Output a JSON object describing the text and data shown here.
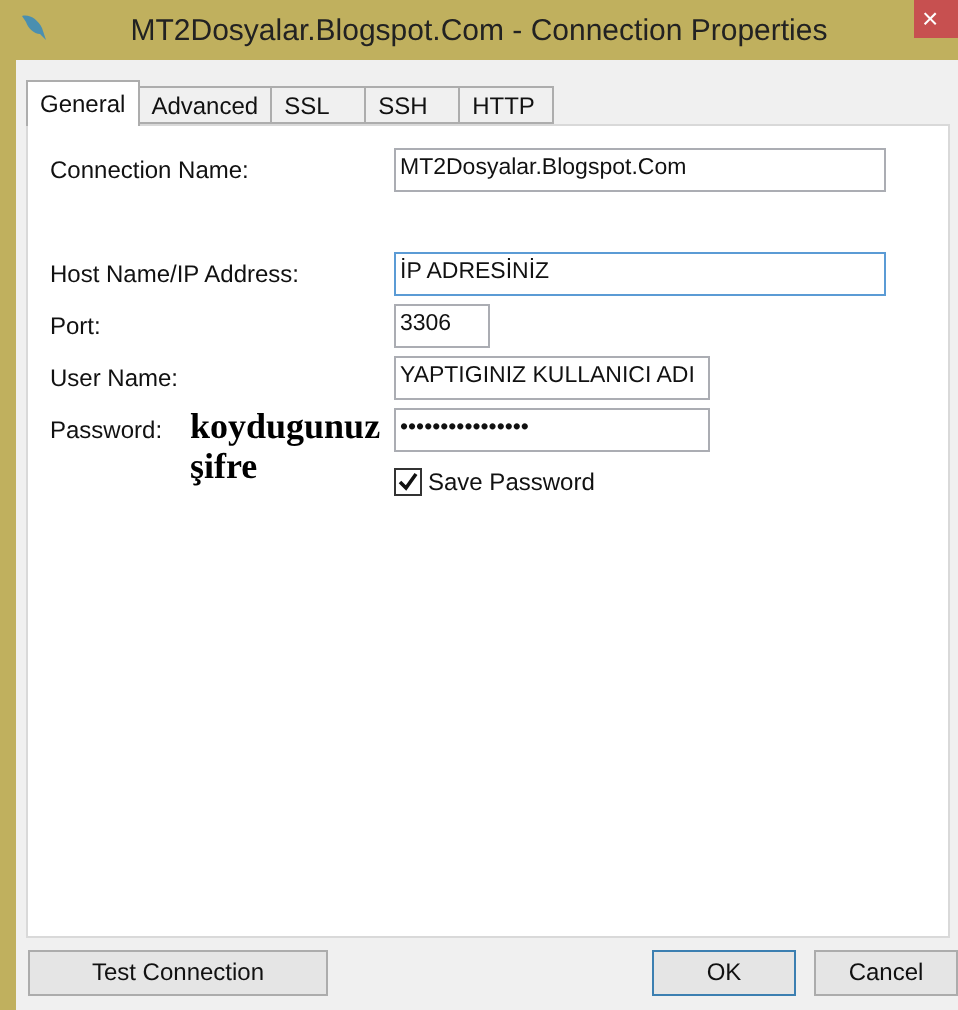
{
  "window": {
    "title": "MT2Dosyalar.Blogspot.Com - Connection Properties",
    "close": "×"
  },
  "tabs": [
    {
      "label": "General",
      "selected": true
    },
    {
      "label": "Advanced",
      "selected": false
    },
    {
      "label": "SSL",
      "selected": false
    },
    {
      "label": "SSH",
      "selected": false
    },
    {
      "label": "HTTP",
      "selected": false
    }
  ],
  "fields": [
    {
      "label": "Connection Name:",
      "value": "MT2Dosyalar.Blogspot.Com",
      "focused": false
    },
    {
      "label": "Host Name/IP Address:",
      "value": "İP ADRESİNİZ",
      "focused": true
    },
    {
      "label": "Port:",
      "value": "3306",
      "focused": false
    },
    {
      "label": "User Name:",
      "value": "YAPTIGINIZ KULLANICI ADI",
      "focused": false
    },
    {
      "label": "Password:",
      "value": "••••••••••••••••",
      "focused": false
    }
  ],
  "save_password": {
    "label": "Save Password",
    "checked": true
  },
  "annotation": "koydugunuz şifre",
  "buttons": [
    {
      "label": "Test Connection",
      "default": false
    },
    {
      "label": "OK",
      "default": true
    },
    {
      "label": "Cancel",
      "default": false
    }
  ]
}
